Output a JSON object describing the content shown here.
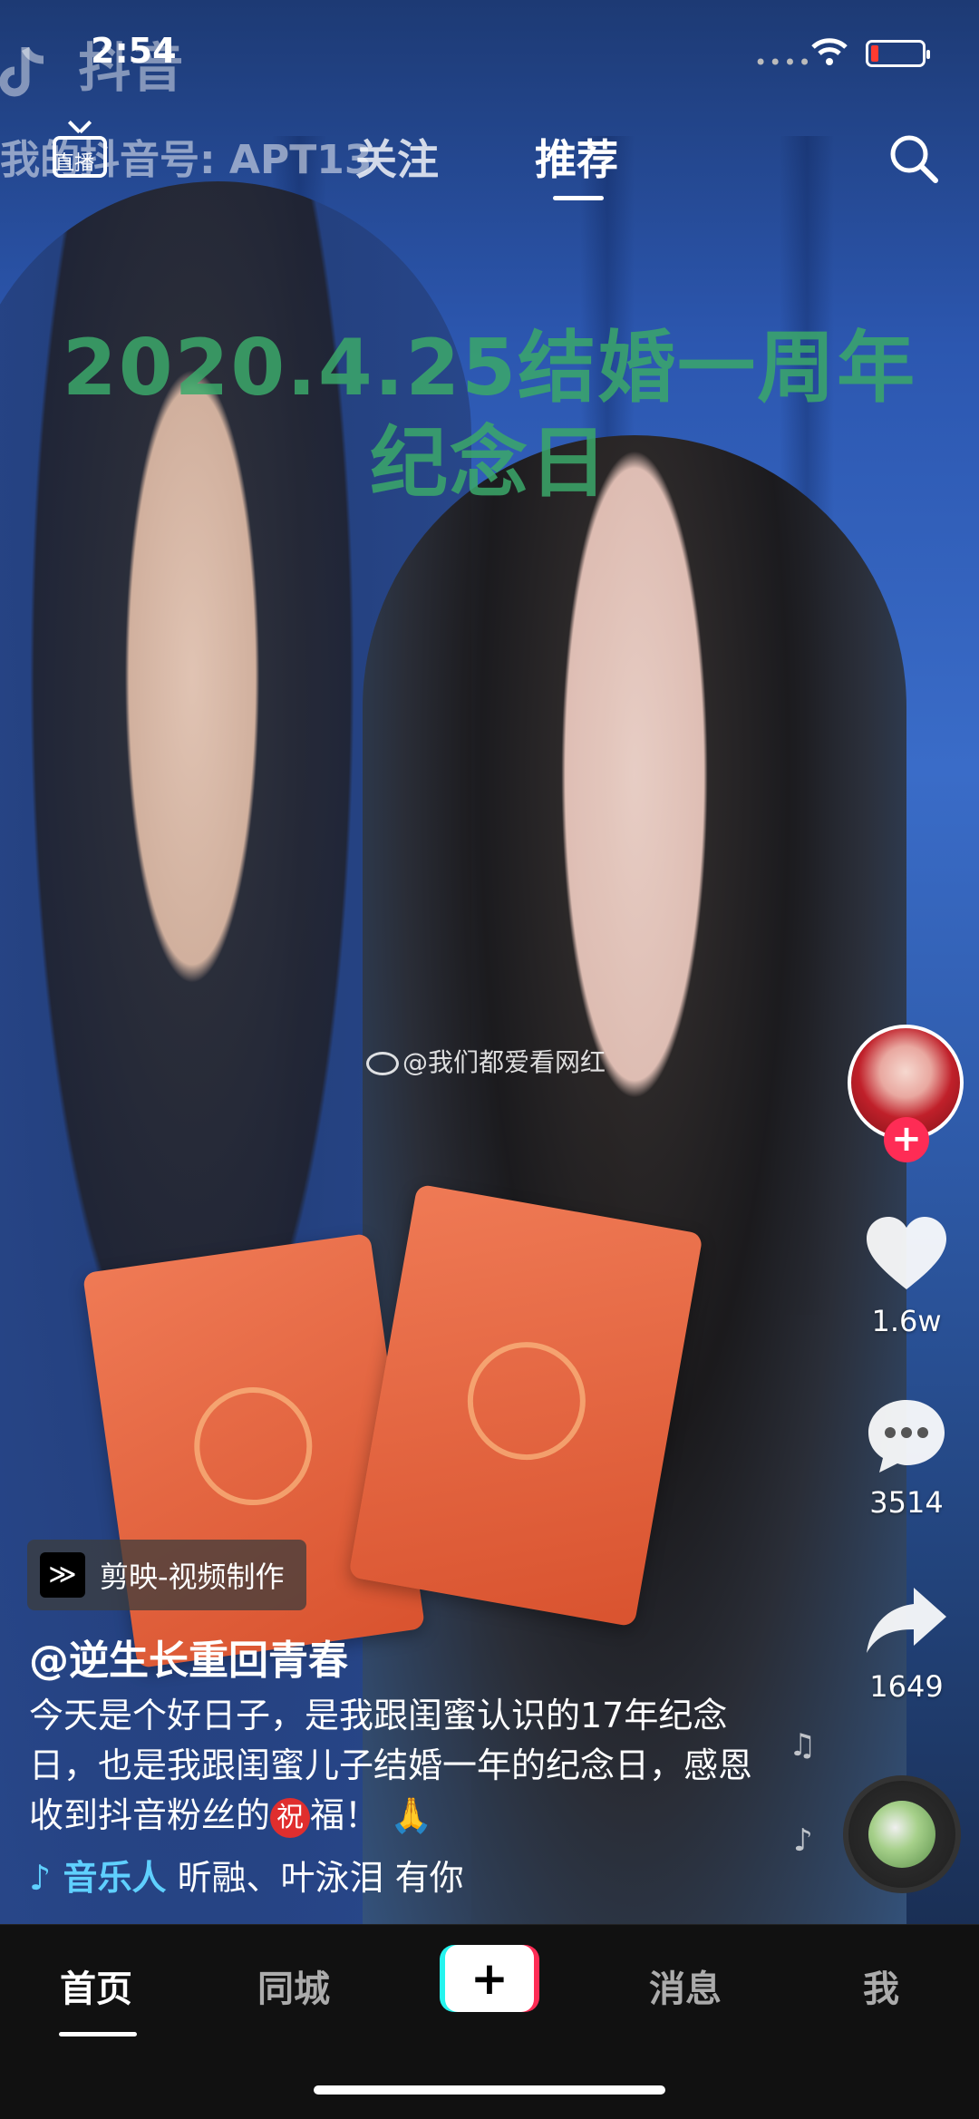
{
  "status_bar": {
    "time": "2:54",
    "signal": "••••",
    "icons": [
      "wifi-icon",
      "battery-icon"
    ],
    "battery_color": "#ff3b30"
  },
  "watermark": {
    "app_name": "抖音",
    "id_text": "我的抖音号: APT13"
  },
  "top_nav": {
    "live_label": "直播",
    "follow": "关注",
    "recommend": "推荐",
    "active": "推荐"
  },
  "video": {
    "overlay_line1": "2020.4.25结婚一周年",
    "overlay_line2": "纪念日",
    "overlay_color": "#3ba86a",
    "weibo_watermark": "@我们都爱看网红"
  },
  "side_actions": {
    "follow_plus": "+",
    "likes": "1.6w",
    "comments": "3514",
    "shares": "1649"
  },
  "post": {
    "capcut_tag": "剪映-视频制作",
    "username": "@逆生长重回青春",
    "caption_part1": "今天是个好日子，是我跟闺蜜认识的17年纪念日，也是我跟闺蜜儿子结婚一年的纪念日，感恩收到抖音粉丝的",
    "caption_zhu": "祝",
    "caption_part2": "福！ 🙏",
    "music_label": "♪ 音乐人",
    "music_song": "昕融、叶泳泪    有你"
  },
  "tab_bar": {
    "tabs": [
      "首页",
      "同城",
      "+",
      "消息",
      "我"
    ],
    "active": "首页",
    "accent_cyan": "#25f4ee",
    "accent_red": "#fe2c55"
  }
}
